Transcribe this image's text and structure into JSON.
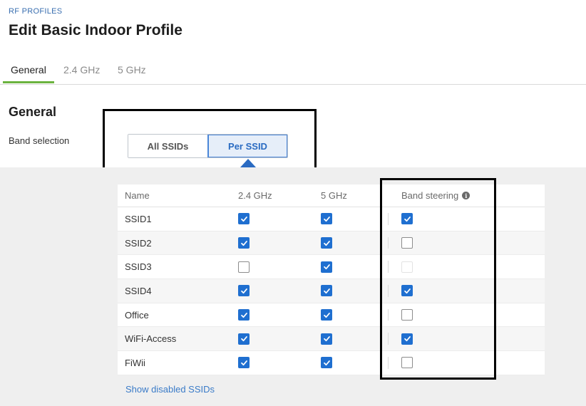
{
  "breadcrumb": "RF PROFILES",
  "title": "Edit Basic Indoor Profile",
  "tabs": [
    {
      "label": "General",
      "active": true
    },
    {
      "label": "2.4 GHz",
      "active": false
    },
    {
      "label": "5 GHz",
      "active": false
    }
  ],
  "section_title": "General",
  "band_selection": {
    "label": "Band selection",
    "options": [
      "All SSIDs",
      "Per SSID"
    ],
    "selected": "Per SSID"
  },
  "table": {
    "headers": {
      "name": "Name",
      "g24": "2.4 GHz",
      "g5": "5 GHz",
      "band_steering": "Band steering"
    },
    "rows": [
      {
        "name": "SSID1",
        "g24": "checked",
        "g5": "checked",
        "band_steering": "checked"
      },
      {
        "name": "SSID2",
        "g24": "checked",
        "g5": "checked",
        "band_steering": "unchecked"
      },
      {
        "name": "SSID3",
        "g24": "unchecked",
        "g5": "checked",
        "band_steering": "disabled"
      },
      {
        "name": "SSID4",
        "g24": "checked",
        "g5": "checked",
        "band_steering": "checked"
      },
      {
        "name": "Office",
        "g24": "checked",
        "g5": "checked",
        "band_steering": "unchecked"
      },
      {
        "name": "WiFi-Access",
        "g24": "checked",
        "g5": "checked",
        "band_steering": "checked"
      },
      {
        "name": "FiWii",
        "g24": "checked",
        "g5": "checked",
        "band_steering": "unchecked"
      }
    ]
  },
  "show_disabled_link": "Show disabled SSIDs",
  "colors": {
    "accent": "#1f6fd0",
    "tab_underline": "#6bb33f",
    "link": "#3a7bc8"
  }
}
